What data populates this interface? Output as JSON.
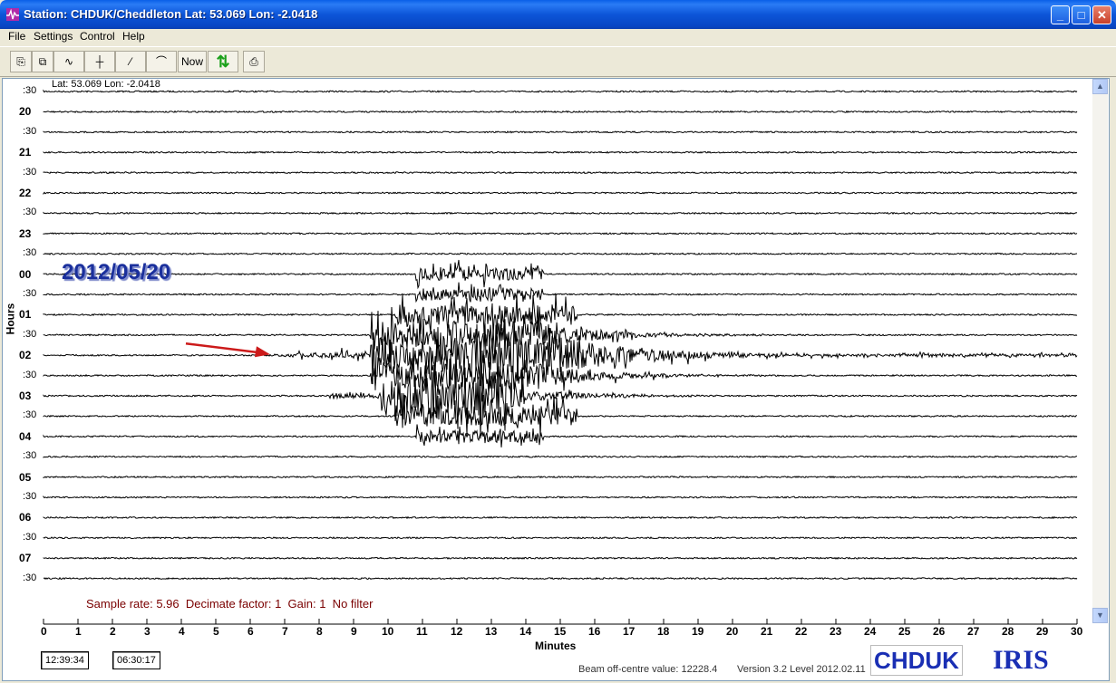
{
  "window": {
    "title": "Station: CHDUK/Cheddleton Lat: 53.069 Lon: -2.0418",
    "minimize_glyph": "_",
    "maximize_glyph": "□",
    "close_glyph": "✕"
  },
  "menu": [
    "File",
    "Settings",
    "Control",
    "Help"
  ],
  "toolbar": {
    "buttons": [
      {
        "name": "open-icon",
        "glyph": "⎘"
      },
      {
        "name": "copy-icon",
        "glyph": "⧉"
      },
      {
        "name": "waveform-icon",
        "glyph": "∿"
      },
      {
        "name": "marker-icon",
        "glyph": "┼"
      },
      {
        "name": "slope-icon",
        "glyph": "⁄"
      },
      {
        "name": "peak-icon",
        "glyph": "⌒"
      },
      {
        "name": "now-button",
        "glyph": "Now"
      },
      {
        "name": "arrows-icon",
        "glyph": "⇅"
      },
      {
        "name": "print-icon",
        "glyph": "⎙"
      }
    ]
  },
  "plot": {
    "latlon": "Lat: 53.069 Lon: -2.0418",
    "date": "2012/05/20",
    "sample_info": "Sample rate: 5.96  Decimate factor: 1  Gain: 1  No filter",
    "x_axis_label": "Minutes",
    "y_axis_label": "Hours",
    "row_labels": [
      ":30",
      "20",
      ":30",
      "21",
      ":30",
      "22",
      ":30",
      "23",
      ":30",
      "00",
      ":30",
      "01",
      ":30",
      "02",
      ":30",
      "03",
      ":30",
      "04",
      ":30",
      "05",
      ":30",
      "06",
      ":30",
      "07",
      ":30"
    ],
    "x_ticks": [
      "0",
      "1",
      "2",
      "3",
      "4",
      "5",
      "6",
      "7",
      "8",
      "9",
      "10",
      "11",
      "12",
      "13",
      "14",
      "15",
      "16",
      "17",
      "18",
      "19",
      "20",
      "21",
      "22",
      "23",
      "24",
      "25",
      "26",
      "27",
      "28",
      "29",
      "30"
    ],
    "arrow_color": "#cc1a1a",
    "trace_color": "#000000"
  },
  "status": {
    "time1": "12:39:34",
    "time2": "06:30:17",
    "beam": "Beam off-centre value: 12228.4",
    "version": "Version 3.2 Level 2012.02.11",
    "logo_left": "CHDUK",
    "logo_right": "IRIS"
  },
  "chart_data": {
    "type": "line",
    "title": "",
    "xlabel": "Minutes",
    "ylabel": "Hours",
    "xlim": [
      0,
      30
    ],
    "rows": [
      ":30",
      "20",
      ":30",
      "21",
      ":30",
      "22",
      ":30",
      "23",
      ":30",
      "00",
      ":30",
      "01",
      ":30",
      "02",
      ":30",
      "03",
      ":30",
      "04",
      ":30",
      "05",
      ":30",
      "06",
      ":30",
      "07",
      ":30"
    ],
    "event": {
      "start_minute": 6.7,
      "peak_minutes": [
        10.5,
        14.5
      ],
      "decay_end_minute": 22,
      "main_rows": [
        "02",
        ":30",
        "03"
      ]
    }
  }
}
